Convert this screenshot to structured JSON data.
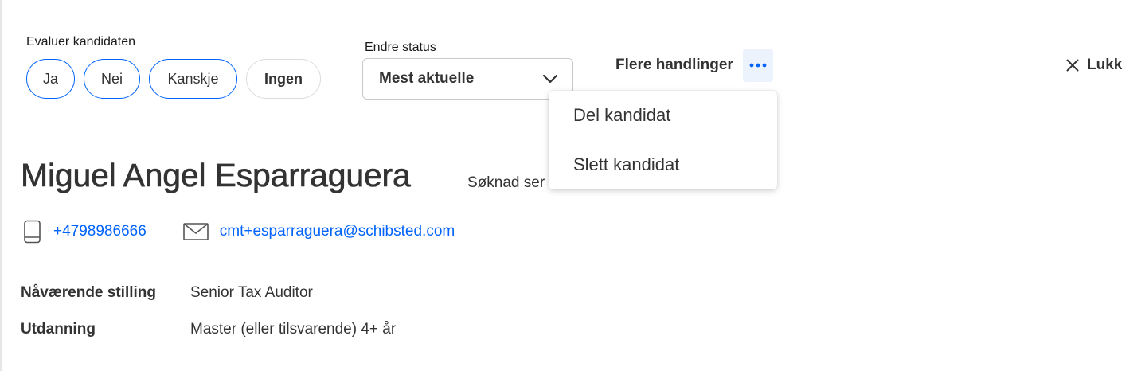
{
  "evaluate": {
    "label": "Evaluer kandidaten",
    "options": [
      "Ja",
      "Nei",
      "Kanskje",
      "Ingen"
    ]
  },
  "status": {
    "label": "Endre status",
    "selected": "Mest aktuelle"
  },
  "actions": {
    "more_label": "Flere handlinger",
    "more_icon": "ellipsis-icon",
    "close_label": "Lukk",
    "menu_items": [
      "Del kandidat",
      "Slett kandidat"
    ]
  },
  "candidate": {
    "name": "Miguel Angel Esparraguera",
    "application_partial": "Søknad ser",
    "phone": "+4798986666",
    "email": "cmt+esparraguera@schibsted.com",
    "details": [
      {
        "label": "Nåværende stilling",
        "value": "Senior Tax Auditor"
      },
      {
        "label": "Utdanning",
        "value": "Master (eller tilsvarende) 4+ år"
      }
    ]
  },
  "colors": {
    "accent": "#0063fb",
    "text": "#333333",
    "more_button_bg": "#edf3fd"
  }
}
